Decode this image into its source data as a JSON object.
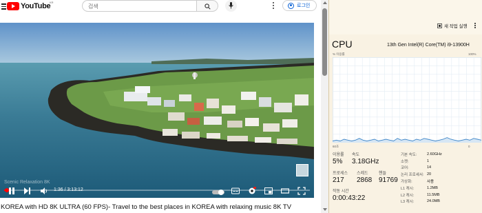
{
  "youtube": {
    "logo_text": "YouTube",
    "country_code": "KR",
    "search_placeholder": "검색",
    "login_label": "로그인",
    "video": {
      "watermark": "Scenic Relaxation 8K",
      "current_time": "1:36",
      "duration": "3:13:12",
      "progress": 0.008
    },
    "title": "KOREA with HD 8K ULTRA (60 FPS)- Travel to the best places in KOREA with relaxing music 8K TV"
  },
  "task_manager": {
    "run_task_label": "새 작업 실행",
    "section_title": "CPU",
    "cpu_model": "13th Gen Intel(R) Core(TM) i9-13900H",
    "graph_label": "% 이용률",
    "graph_max": "100%",
    "graph_min": "0",
    "graph_time": "60초",
    "graph_series": [
      2,
      3,
      2,
      4,
      3,
      2,
      3,
      5,
      3,
      2,
      3,
      4,
      2,
      3,
      4,
      3,
      2,
      5,
      3,
      4,
      3,
      2,
      4,
      3,
      5,
      4,
      3,
      2,
      3,
      4,
      6,
      4,
      3,
      2,
      3,
      4,
      3,
      5,
      4,
      3
    ],
    "stats": {
      "utilization_label": "이용률",
      "utilization_value": "5%",
      "speed_label": "속도",
      "speed_value": "3.18GHz",
      "processes_label": "프로세스",
      "processes_value": "217",
      "threads_label": "스레드",
      "threads_value": "2868",
      "handles_label": "핸들",
      "handles_value": "91769",
      "uptime_label": "작동 시간",
      "uptime_value": "0:00:43:22"
    },
    "specs": [
      {
        "key": "기본 속도:",
        "value": "2.60GHz"
      },
      {
        "key": "소켓:",
        "value": "1"
      },
      {
        "key": "코어:",
        "value": "14"
      },
      {
        "key": "논리 프로세서:",
        "value": "20"
      },
      {
        "key": "가상화:",
        "value": "사용"
      },
      {
        "key": "L1 캐시:",
        "value": "1.2MB"
      },
      {
        "key": "L2 캐시:",
        "value": "11.5MB"
      },
      {
        "key": "L3 캐시:",
        "value": "24.0MB"
      }
    ]
  }
}
